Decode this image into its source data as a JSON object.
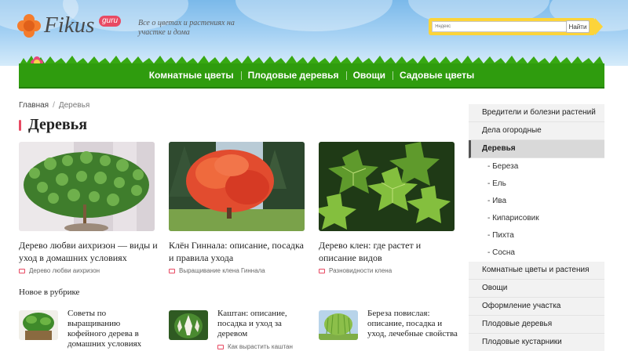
{
  "header": {
    "logo_text": "Fikus",
    "logo_badge": "guru",
    "tagline": "Все о цветах и растениях на участке и дома",
    "search_placeholder": "Яндекс",
    "search_button": "Найти"
  },
  "nav": {
    "items": [
      "Комнатные цветы",
      "Плодовые деревья",
      "Овощи",
      "Садовые цветы"
    ]
  },
  "breadcrumb": {
    "home": "Главная",
    "separator": "/",
    "current": "Деревья"
  },
  "page_title": "Деревья",
  "articles": [
    {
      "title": "Дерево любви аихризон — виды и уход в домашних условиях",
      "category": "Дерево любви аихризон"
    },
    {
      "title": "Клён Гиннала: описание, посадка и правила ухода",
      "category": "Выращивание клена Гиннала"
    },
    {
      "title": "Дерево клен: где растет и описание видов",
      "category": "Разновидности клена"
    }
  ],
  "new_section": {
    "title": "Новое в рубрике",
    "items": [
      {
        "title": "Советы по выращиванию кофейного дерева в домашних условиях",
        "category": ""
      },
      {
        "title": "Каштан: описание, посадка и уход за деревом",
        "category": "Как вырастить каштан"
      },
      {
        "title": "Береза повислая: описание, посадка и уход, лечебные свойства",
        "category": ""
      }
    ]
  },
  "sidebar": {
    "items": [
      {
        "label": "Вредители и болезни растений"
      },
      {
        "label": "Дела огородные"
      },
      {
        "label": "Деревья"
      },
      {
        "label": "- Береза"
      },
      {
        "label": "- Ель"
      },
      {
        "label": "- Ива"
      },
      {
        "label": "- Кипарисовик"
      },
      {
        "label": "- Пихта"
      },
      {
        "label": "- Сосна"
      },
      {
        "label": "Комнатные цветы и растения"
      },
      {
        "label": "Овощи"
      },
      {
        "label": "Оформление участка"
      },
      {
        "label": "Плодовые деревья"
      },
      {
        "label": "Плодовые кустарники"
      }
    ]
  },
  "colors": {
    "accent": "#e84a63",
    "nav_green": "#2f9c0e",
    "search_yellow": "#fcd43a",
    "logo_orange": "#f47c2c"
  }
}
